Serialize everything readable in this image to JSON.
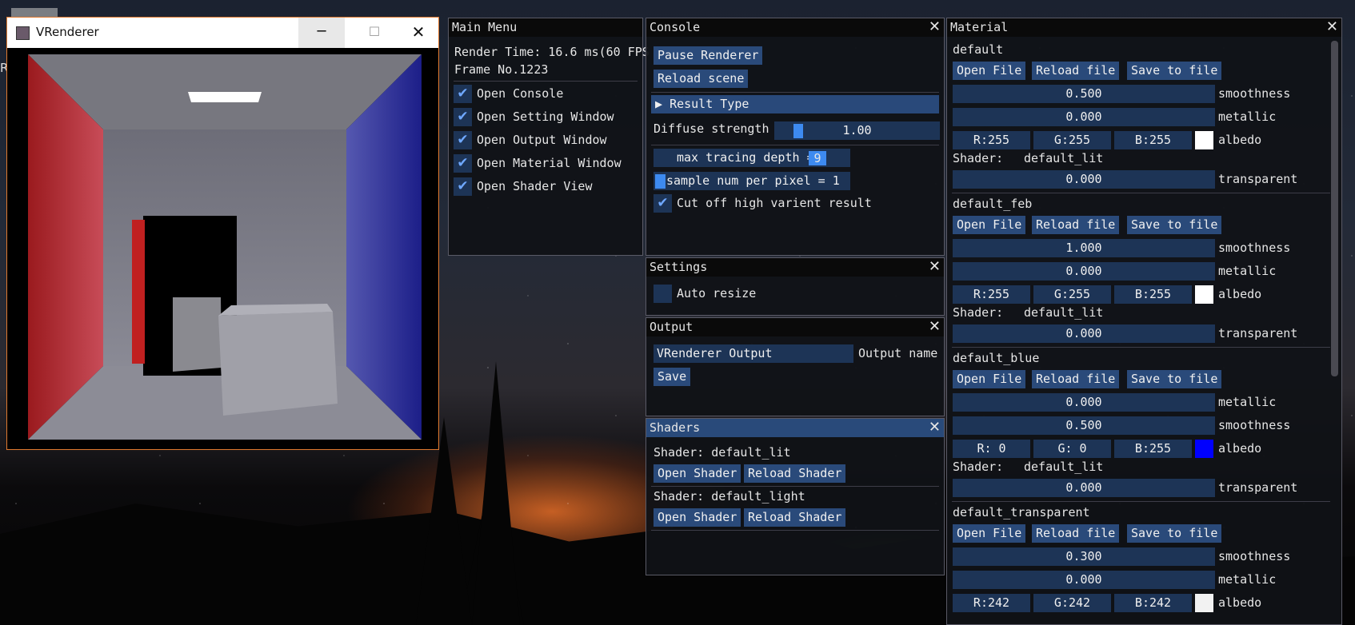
{
  "vrenderer": {
    "title": "VRenderer"
  },
  "main_menu": {
    "title": "Main Menu",
    "render_time": "Render Time: 16.6 ms(60 FPS",
    "frame": "Frame No.1223",
    "items": [
      "Open Console",
      "Open Setting Window",
      "Open Output Window",
      "Open Material Window",
      "Open Shader View"
    ]
  },
  "console": {
    "title": "Console",
    "pause": "Pause Renderer",
    "reload": "Reload scene",
    "result_type": "Result Type",
    "diffuse_label": "Diffuse strength",
    "diffuse_value": "1.00",
    "depth_label": "max tracing depth =",
    "depth_value": "9",
    "sample_label": "sample num per pixel = 1",
    "cutoff_label": "Cut off high varient result"
  },
  "settings": {
    "title": "Settings",
    "auto_resize": "Auto resize"
  },
  "output": {
    "title": "Output",
    "name_value": "VRenderer Output",
    "name_label": "Output name",
    "save": "Save"
  },
  "shaders": {
    "title": "Shaders",
    "list": [
      {
        "label": "Shader: default_lit",
        "open": "Open Shader",
        "reload": "Reload Shader"
      },
      {
        "label": "Shader: default_light",
        "open": "Open Shader",
        "reload": "Reload Shader"
      }
    ]
  },
  "material": {
    "title": "Material",
    "open": "Open File",
    "reload": "Reload file",
    "save": "Save to file",
    "shader_label": "Shader:",
    "materials": [
      {
        "name": "default",
        "rows": [
          [
            "0.500",
            "smoothness"
          ],
          [
            "0.000",
            "metallic"
          ]
        ],
        "r": "R:255",
        "g": "G:255",
        "b": "B:255",
        "albedo": "albedo",
        "color": "#ffffff",
        "shader": "default_lit",
        "transparent": "0.000",
        "transparent_label": "transparent"
      },
      {
        "name": "default_feb",
        "rows": [
          [
            "1.000",
            "smoothness"
          ],
          [
            "0.000",
            "metallic"
          ]
        ],
        "r": "R:255",
        "g": "G:255",
        "b": "B:255",
        "albedo": "albedo",
        "color": "#ffffff",
        "shader": "default_lit",
        "transparent": "0.000",
        "transparent_label": "transparent"
      },
      {
        "name": "default_blue",
        "rows": [
          [
            "0.000",
            "metallic"
          ],
          [
            "0.500",
            "smoothness"
          ]
        ],
        "r": "R:  0",
        "g": "G:  0",
        "b": "B:255",
        "albedo": "albedo",
        "color": "#0000ff",
        "shader": "default_lit",
        "transparent": "0.000",
        "transparent_label": "transparent"
      },
      {
        "name": "default_transparent",
        "rows": [
          [
            "0.300",
            "smoothness"
          ],
          [
            "0.000",
            "metallic"
          ]
        ],
        "r": "R:242",
        "g": "G:242",
        "b": "B:242",
        "albedo": "albedo",
        "color": "#f2f2f2"
      }
    ]
  }
}
